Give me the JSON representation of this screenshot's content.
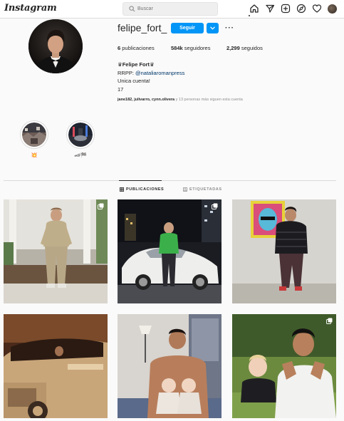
{
  "header": {
    "logo_text": "Instagram",
    "search_placeholder": "Buscar",
    "nav_icons": [
      "home-icon",
      "direct-icon",
      "new-post-icon",
      "explore-icon",
      "activity-heart-icon",
      "profile-avatar"
    ]
  },
  "profile": {
    "username": "felipe_fort_",
    "follow_label": "Seguir",
    "stats": {
      "posts_count": "6",
      "posts_label": "publicaciones",
      "followers_count": "584k",
      "followers_label": "seguidores",
      "following_count": "2,299",
      "following_label": "seguidos"
    },
    "bio": {
      "name": "♛Felipe Fort♛",
      "line1_prefix": "RRPP: ",
      "line1_link": "@nataliaromanpress",
      "line2": "Unica cuenta!",
      "line3": "17"
    },
    "followed_by": {
      "names": "jane182, julivarro, cynn.olivera",
      "rest": " y 13 personas más siguen esta cuenta"
    }
  },
  "highlights": [
    {
      "label": "💥"
    },
    {
      "label": "🏎🏁"
    }
  ],
  "tabs": [
    {
      "label": "PUBLICACIONES",
      "icon": "grid-icon",
      "active": true
    },
    {
      "label": "ETIQUETADAS",
      "icon": "tagged-icon",
      "active": false
    }
  ],
  "colors": {
    "accent": "#0095f6",
    "background": "#fafafa",
    "text": "#262626",
    "secondary_text": "#8e8e8e",
    "border": "#dbdbdb"
  }
}
